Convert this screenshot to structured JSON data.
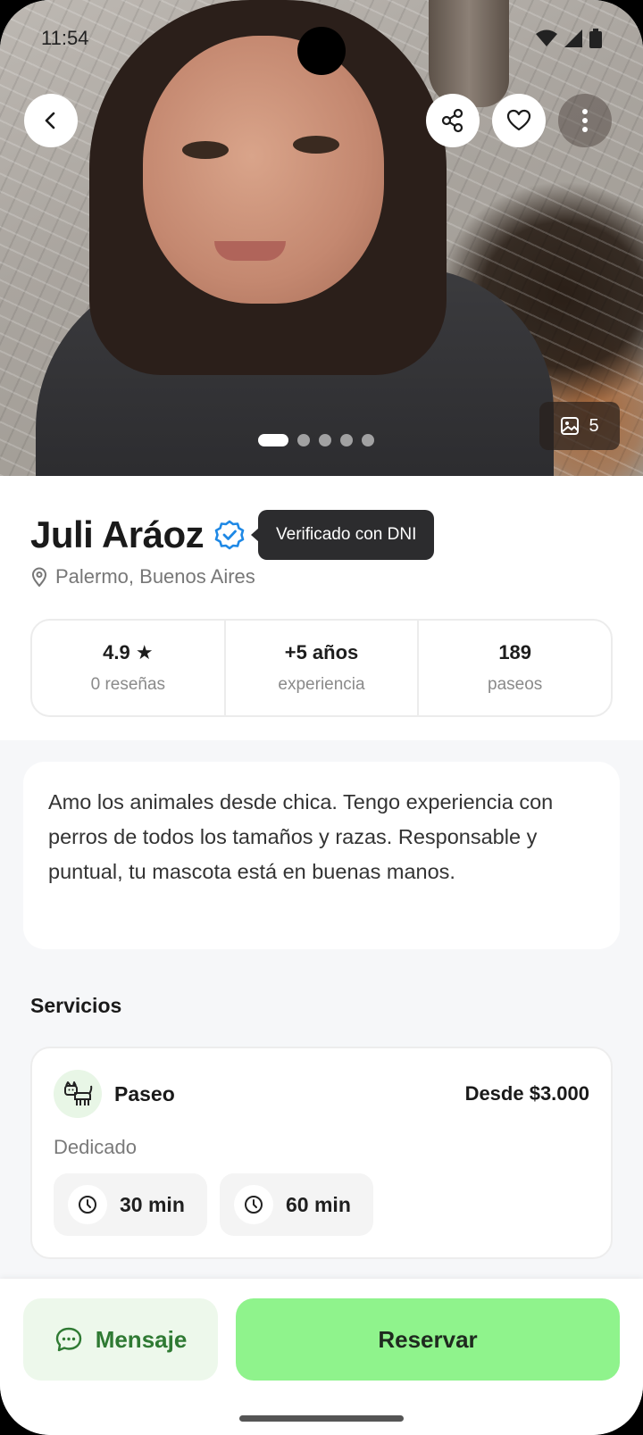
{
  "status_bar": {
    "time": "11:54"
  },
  "hero": {
    "photo_count": "5",
    "carousel_dots": 5,
    "active_dot": 0
  },
  "profile": {
    "name": "Juli Aráoz",
    "verified_tooltip": "Verificado con DNI",
    "location": "Palermo, Buenos Aires",
    "stats": [
      {
        "value": "4.9 ★",
        "label": "0 reseñas"
      },
      {
        "value": "+5 años",
        "label": "experiencia"
      },
      {
        "value": "189",
        "label": "paseos"
      }
    ]
  },
  "bio": "Amo los animales desde chica. Tengo experiencia con perros de todos los tamaños y razas. Responsable y puntual, tu mascota está en buenas manos.",
  "services": {
    "title": "Servicios",
    "items": [
      {
        "name": "Paseo",
        "price": "Desde $3.000",
        "type": "Dedicado",
        "durations": [
          "30 min",
          "60 min"
        ]
      }
    ]
  },
  "actions": {
    "message_label": "Mensaje",
    "book_label": "Reservar"
  },
  "colors": {
    "accent_green": "#8ff38c",
    "message_green": "#2f7a33",
    "verified_blue": "#1e88e5"
  }
}
